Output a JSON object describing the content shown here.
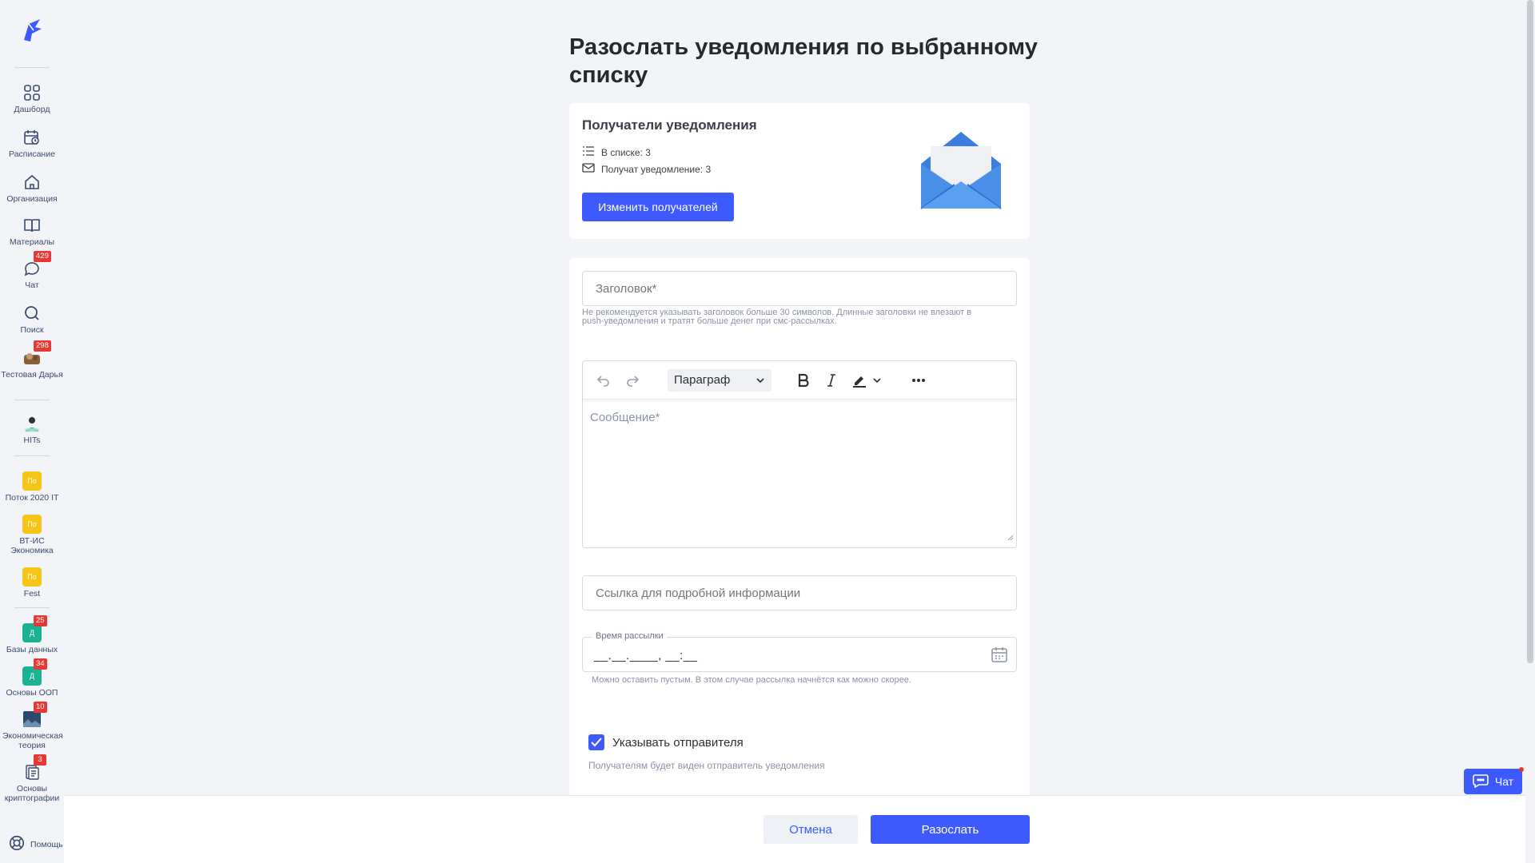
{
  "sidebar": {
    "items": [
      {
        "label": "Дашборд",
        "icon": "grid-icon"
      },
      {
        "label": "Расписание",
        "icon": "calendar-clock-icon"
      },
      {
        "label": "Организация",
        "icon": "home-icon"
      },
      {
        "label": "Материалы",
        "icon": "book-icon"
      },
      {
        "label": "Чат",
        "icon": "chat-icon",
        "badge": "429"
      },
      {
        "label": "Поиск",
        "icon": "search-icon"
      },
      {
        "label": "Тестовая Дарья",
        "icon": "user-avatar",
        "badge": "298"
      },
      {
        "label": "HITs",
        "icon": "hits-avatar"
      },
      {
        "label": "Поток 2020 IT",
        "avatar_text": "По"
      },
      {
        "label": "ВТ-ИС Экономика",
        "avatar_text": "По"
      },
      {
        "label": "Fest",
        "avatar_text": "По"
      },
      {
        "label": "Базы данных",
        "avatar_text": "Д",
        "badge": "25"
      },
      {
        "label": "Основы ООП",
        "avatar_text": "Д",
        "badge": "34"
      },
      {
        "label": "Экономическая теория",
        "icon": "image-avatar",
        "badge": "10"
      },
      {
        "label": "Основы криптографии",
        "icon": "doc-avatar",
        "badge": "3"
      }
    ],
    "help_label": "Помощь"
  },
  "page": {
    "title": "Разослать уведомления по выбранному списку"
  },
  "recipients": {
    "heading": "Получатели уведомления",
    "in_list": "В списке: 3",
    "will_receive": "Получат уведомление: 3",
    "change_button": "Изменить получателей"
  },
  "form": {
    "title_placeholder": "Заголовок*",
    "title_hint_1": "Не рекомендуется указывать заголовок больше 30 символов. Длинные заголовки не влезают в",
    "title_hint_2": "push-уведомления и тратят больше денег при смс-рассылках.",
    "editor": {
      "paragraph_label": "Параграф",
      "message_placeholder": "Сообщение*"
    },
    "link_placeholder": "Ссылка для подробной информации",
    "time": {
      "label": "Время рассылки",
      "mask": "__.__.____, __:__",
      "hint": "Можно оставить пустым. В этом случае рассылка начнётся как можно скорее."
    },
    "sender": {
      "checkbox_label": "Указывать отправителя",
      "checked": true,
      "hint": "Получателям будет виден отправитель уведомления"
    }
  },
  "actions": {
    "cancel": "Отмена",
    "send": "Разослать"
  },
  "chat_widget": {
    "label": "Чат"
  },
  "colors": {
    "primary": "#3d5afe",
    "badge": "#e53935",
    "avatar_yellow": "#f5c518",
    "avatar_teal": "#1bb394"
  }
}
